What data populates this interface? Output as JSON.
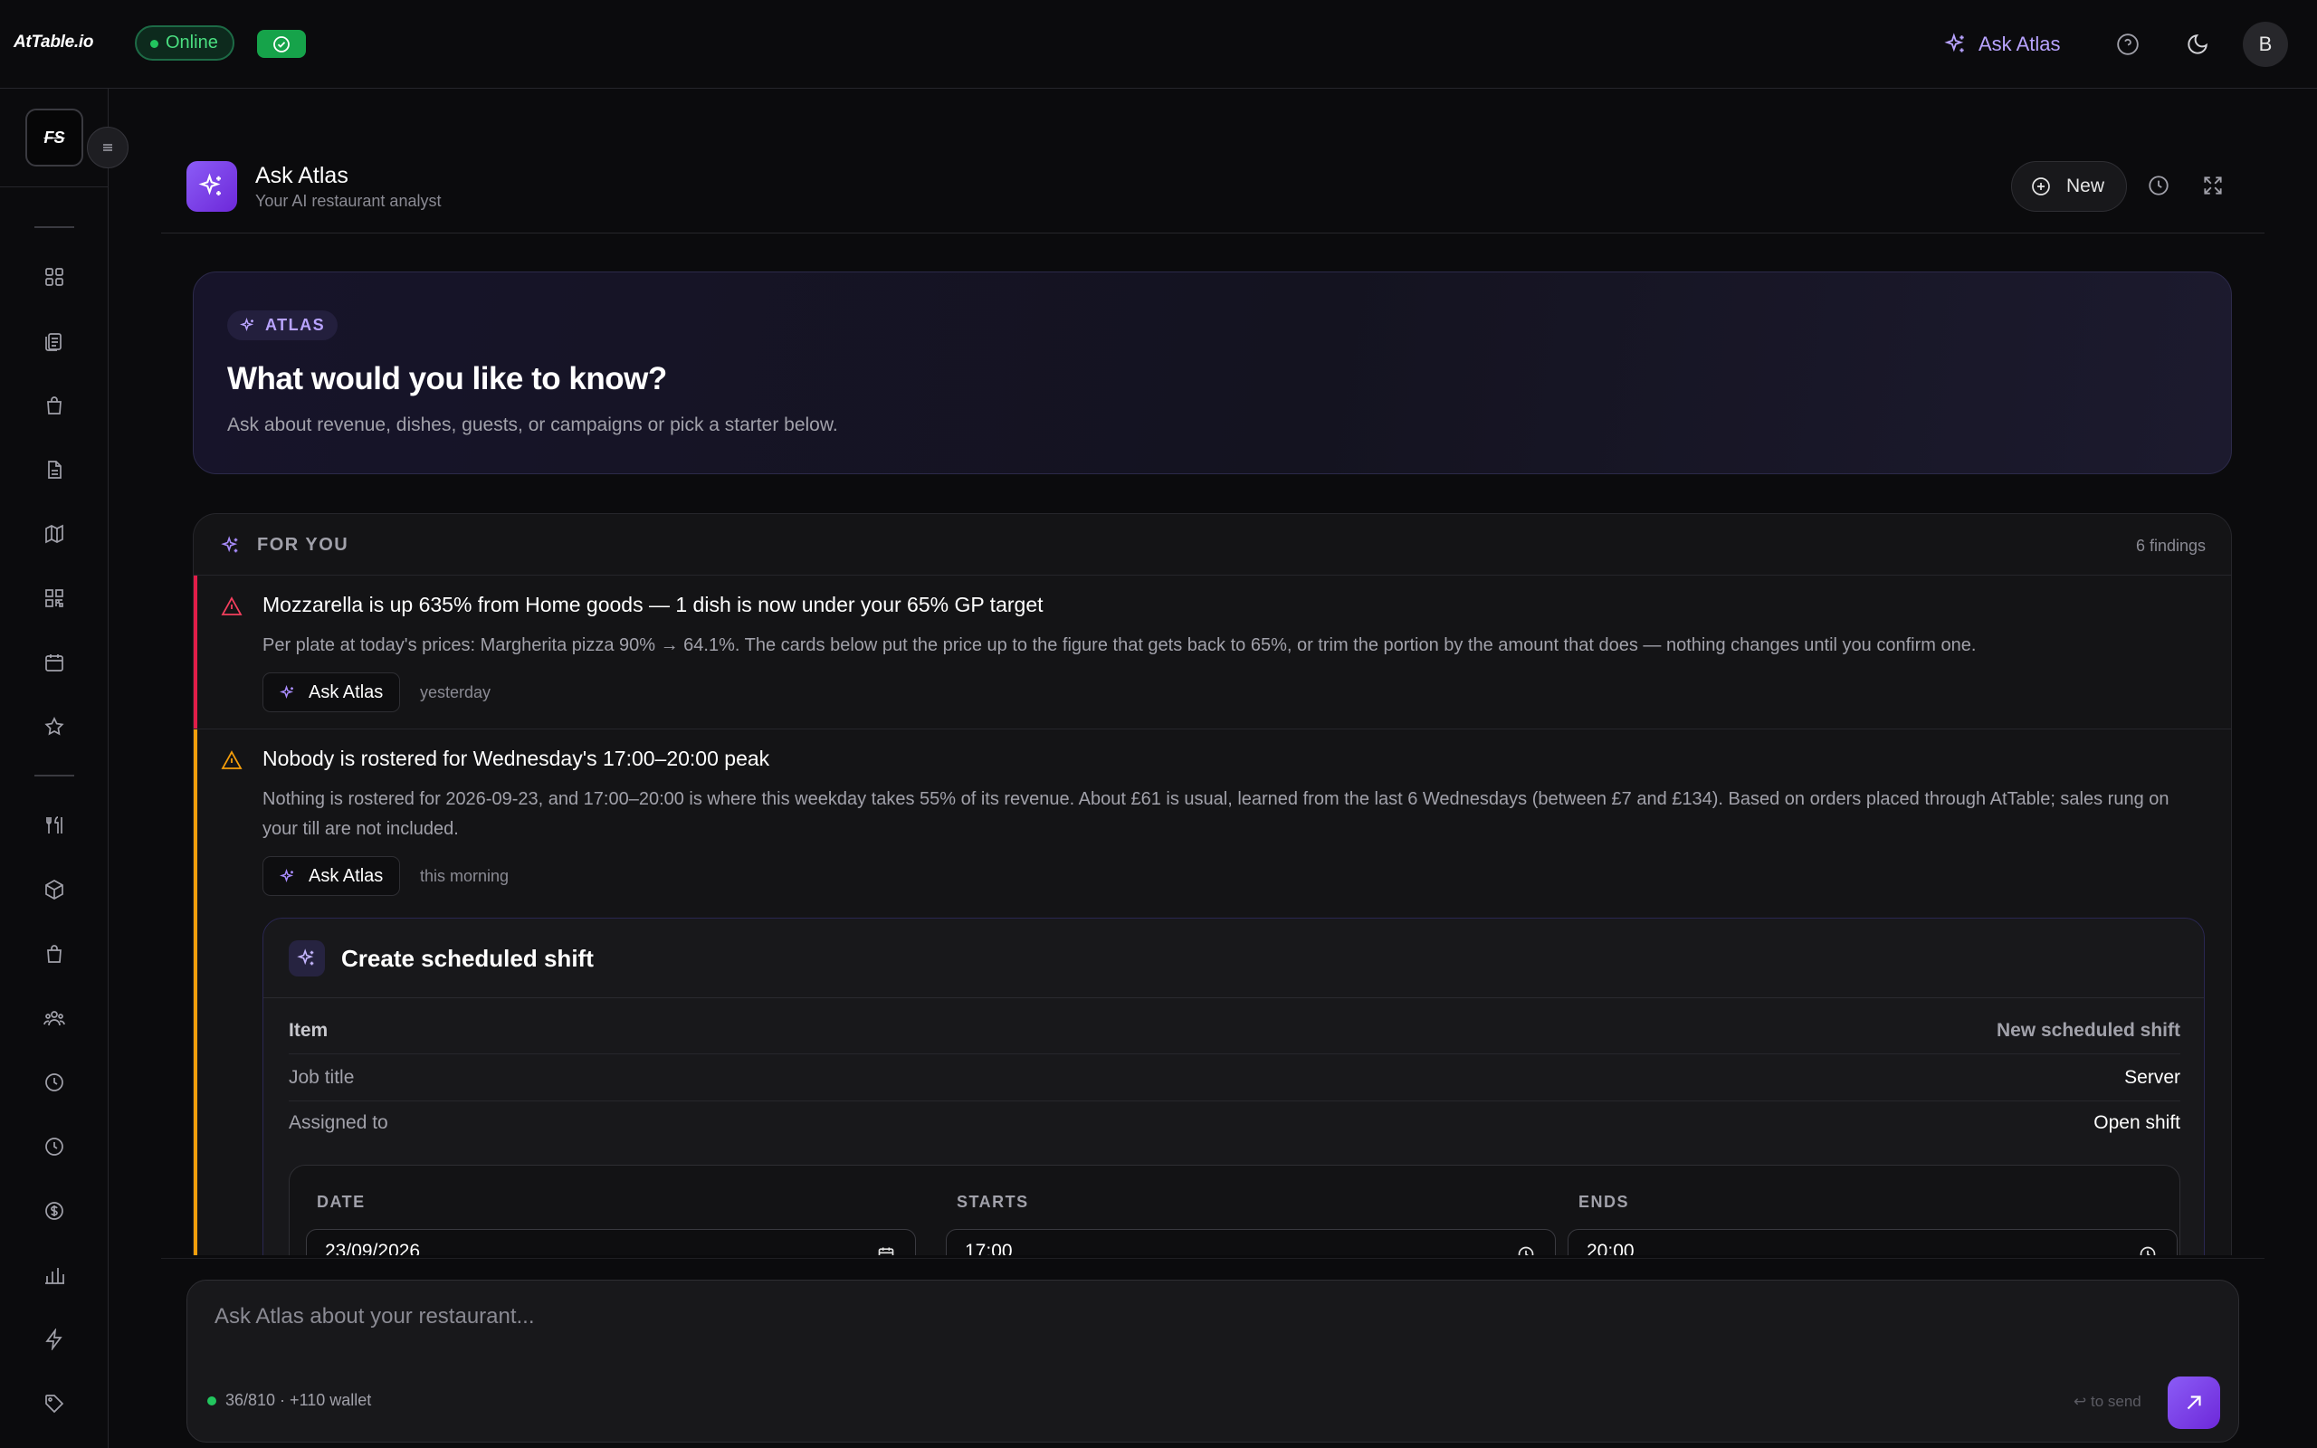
{
  "app": {
    "logo": "AtTable.io",
    "status_label": "Online",
    "brand_mark": "FS"
  },
  "topbar": {
    "ask_atlas_label": "Ask Atlas",
    "avatar_initial": "B",
    "icons": [
      "sparkles-icon",
      "help-circle-icon",
      "moon-icon"
    ]
  },
  "sidebar": {
    "icons": [
      "grid-icon",
      "clipboard-icon",
      "shopping-bag-icon",
      "document-icon",
      "map-icon",
      "qr-code-icon",
      "calendar-icon",
      "star-icon",
      "utensils-icon",
      "box-icon",
      "bag-icon",
      "users-icon",
      "clock-icon",
      "history-icon",
      "dollar-icon",
      "bar-chart-icon",
      "lightning-icon",
      "tag-icon"
    ]
  },
  "panel": {
    "title": "Ask Atlas",
    "subtitle": "Your AI restaurant analyst",
    "new_button": "New"
  },
  "hero": {
    "tag": "ATLAS",
    "title": "What would you like to know?",
    "subtitle": "Ask about revenue, dishes, guests, or campaigns or pick a starter below."
  },
  "for_you": {
    "label": "FOR YOU",
    "count": "6 findings",
    "findings": [
      {
        "severity_color": "#e11d48",
        "title": "Mozzarella is up 635% from Home goods — 1 dish is now under your 65% GP target",
        "body": "Per plate at today's prices: Margherita pizza 90% → 64.1%. The cards below put the price up to the figure that gets back to 65%, or trim the portion by the amount that does — nothing changes until you confirm one.",
        "ask_label": "Ask Atlas",
        "time": "yesterday"
      },
      {
        "severity_color": "#f59e0b",
        "title": "Nobody is rostered for Wednesday's 17:00–20:00 peak",
        "body": "Nothing is rostered for 2026-09-23, and 17:00–20:00 is where this weekday takes 55% of its revenue. About £61 is usual, learned from the last 6 Wednesdays (between £7 and £134). Based on orders placed through AtTable; sales rung on your till are not included.",
        "ask_label": "Ask Atlas",
        "time": "this morning"
      }
    ]
  },
  "action": {
    "title": "Create scheduled shift",
    "rows": [
      {
        "key": "Item",
        "value": "New scheduled shift"
      },
      {
        "key": "Job title",
        "value": "Server"
      },
      {
        "key": "Assigned to",
        "value": "Open shift"
      }
    ],
    "date_label": "DATE",
    "date_value": "23/09/2026",
    "starts_label": "STARTS",
    "starts_value": "17:00",
    "ends_label": "ENDS",
    "ends_value": "20:00"
  },
  "composer": {
    "placeholder": "Ask Atlas about your restaurant...",
    "status": "36/810 · +110 wallet",
    "hint": "↩ to send"
  },
  "colors": {
    "accent": "#8b5cf6",
    "online": "#22c55e",
    "danger": "#e11d48",
    "warning": "#f59e0b"
  }
}
